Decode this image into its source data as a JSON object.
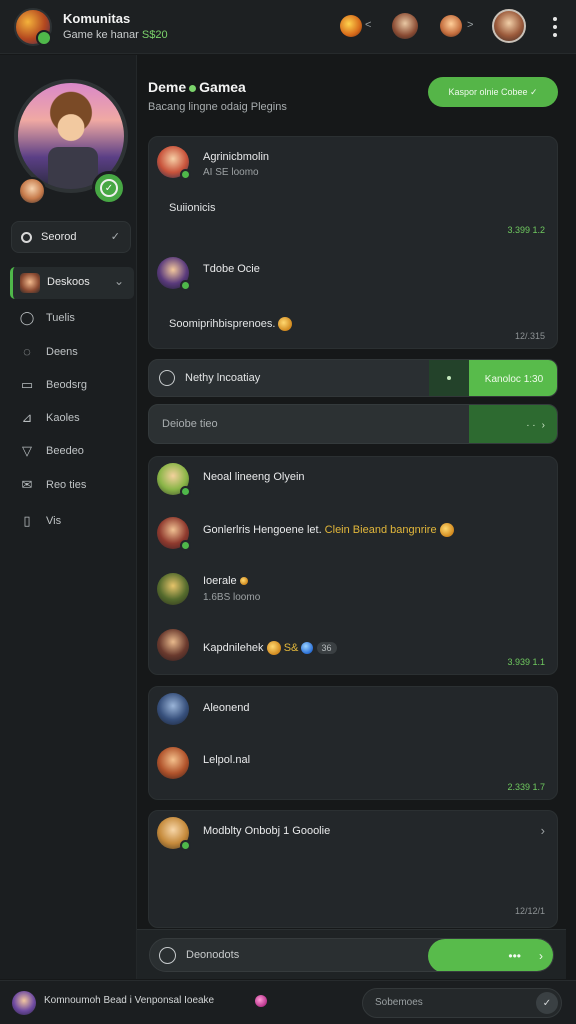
{
  "header": {
    "title": "Komunitas",
    "subtitle_prefix": "Game ke hanar ",
    "subtitle_accent": "S$20",
    "menu_icon": "kebab-icon"
  },
  "sidebar": {
    "search_label": "Seorod",
    "items": [
      {
        "label": "Deskoos",
        "icon": "game-avatar",
        "active": true
      },
      {
        "label": "Tuelis",
        "icon": "search-icon"
      },
      {
        "label": "Deens",
        "icon": "chat-icon"
      },
      {
        "label": "Beodsrg",
        "icon": "inbox-icon"
      },
      {
        "label": "Kaoles",
        "icon": "chart-icon"
      },
      {
        "label": "Beedeo",
        "icon": "filter-icon"
      },
      {
        "label": "Reo ties",
        "icon": "mail-icon"
      },
      {
        "label": "Vis",
        "icon": "book-icon"
      }
    ]
  },
  "main": {
    "title_left": "Deme",
    "title_right": "Gamea",
    "subtitle": "Bacang lingne odaig Plegins",
    "top_button": "Kaspor olnie Cobee ✓",
    "accent_color": "#58bb4b"
  },
  "card1": {
    "m1": {
      "name": "Agrinicbmolin",
      "meta": "AI SE loomo",
      "text": "Suiionicis",
      "time": "3.399 1.2"
    },
    "m2": {
      "name": "Tdobe Ocie",
      "text": "Soomiprihbisprenoes.",
      "time": "12/.315"
    }
  },
  "action1": {
    "label": "Nethy lncoatiay",
    "button": "Kanoloc 1:30"
  },
  "action2": {
    "label": "Deiobe tieo"
  },
  "card2": {
    "m1": {
      "name": "Neoal lineeng Olyein"
    },
    "m2": {
      "name_a": "Gonlerlris Hengoene let.",
      "name_b": " Clein Bieand bangnrire"
    },
    "m3": {
      "name": "Ioerale",
      "meta": "1.6BS loomo"
    },
    "m4": {
      "name": "Kapdnilehek",
      "extra": "S&",
      "count": "36",
      "time": "3.939 1.1"
    }
  },
  "card3": {
    "m1": {
      "name": "Aleonend"
    },
    "m2": {
      "name": "Lelpol.nal",
      "time": "2.339 1.7"
    }
  },
  "card4": {
    "m1": {
      "name": "Modblty Onbobj 1 Gooolie",
      "time": "12/12/1"
    }
  },
  "composer": {
    "placeholder": "Deonodots",
    "send": "•••"
  },
  "footer": {
    "text": "Komnoumoh Bead i Venponsal Ioeake",
    "search_placeholder": "Sobemoes"
  }
}
